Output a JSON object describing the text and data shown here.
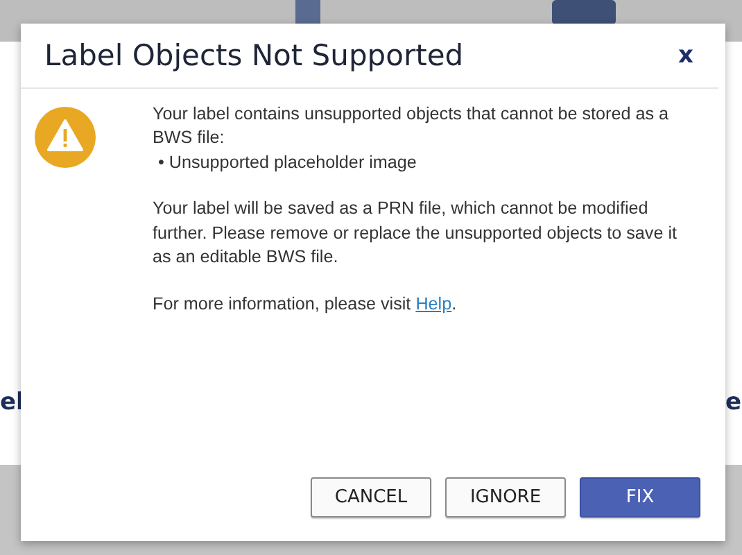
{
  "background": {
    "left_fragment": "el",
    "right_fragment": "e"
  },
  "dialog": {
    "title": "Label Objects Not Supported",
    "close": "x",
    "intro": "Your label contains unsupported objects that cannot be stored as a BWS file:",
    "items": [
      "• Unsupported placeholder image"
    ],
    "note": "Your label will be saved as a PRN file, which cannot be modified further. Please remove or replace the unsupported objects to save it as an editable BWS file.",
    "help_text": "For more information, please visit ",
    "help_link": "Help",
    "help_end": ".",
    "buttons": [
      {
        "label": "CANCEL",
        "primary": false
      },
      {
        "label": "IGNORE",
        "primary": false
      },
      {
        "label": "FIX",
        "primary": true
      }
    ]
  }
}
